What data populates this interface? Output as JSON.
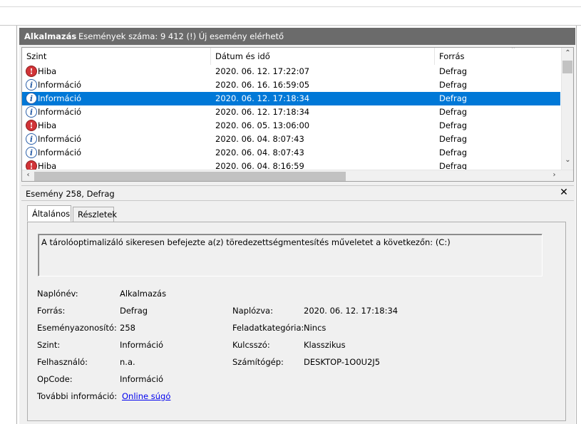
{
  "header": {
    "log_name": "Alkalmazás",
    "event_count": "Események száma: 9 412 (!) Új esemény elérhető"
  },
  "list": {
    "columns": [
      "Szint",
      "Dátum és idő",
      "Forrás"
    ],
    "rows": [
      {
        "icon": "error-icon",
        "level": "Hiba",
        "datetime": "2020. 06. 12. 17:22:07",
        "source": "Defrag"
      },
      {
        "icon": "info-icon",
        "level": "Információ",
        "datetime": "2020. 06. 16. 16:59:05",
        "source": "Defrag"
      },
      {
        "icon": "info-icon",
        "level": "Információ",
        "datetime": "2020. 06. 12. 17:18:34",
        "source": "Defrag",
        "selected": true
      },
      {
        "icon": "info-icon",
        "level": "Információ",
        "datetime": "2020. 06. 12. 17:18:34",
        "source": "Defrag"
      },
      {
        "icon": "error-icon",
        "level": "Hiba",
        "datetime": "2020. 06. 05. 13:06:00",
        "source": "Defrag"
      },
      {
        "icon": "info-icon",
        "level": "Információ",
        "datetime": "2020. 06. 04. 8:07:43",
        "source": "Defrag"
      },
      {
        "icon": "info-icon",
        "level": "Információ",
        "datetime": "2020. 06. 04. 8:07:43",
        "source": "Defrag"
      },
      {
        "icon": "error-icon",
        "level": "Hiba",
        "datetime": "2020. 06. 04. 8:16:59",
        "source": "Defrag"
      }
    ]
  },
  "event": {
    "title": "Esemény 258, Defrag",
    "tabs": [
      "Általános",
      "Részletek"
    ],
    "description": "A tárolóoptimalizáló sikeresen befejezte a(z) töredezettségmentesítés műveletet a következőn: (C:)",
    "left_fields": [
      {
        "label": "Naplónév:",
        "value": "Alkalmazás"
      },
      {
        "label": "Forrás:",
        "value": "Defrag"
      },
      {
        "label": "Eseményazonosító:",
        "value": "258"
      },
      {
        "label": "Szint:",
        "value": "Információ"
      },
      {
        "label": "Felhasználó:",
        "value": "n.a."
      },
      {
        "label": "OpCode:",
        "value": "Információ"
      },
      {
        "label": "További információ:",
        "value": "Online súgó"
      }
    ],
    "right_fields": [
      {
        "label": "Naplózva:",
        "value": "2020. 06. 12. 17:18:34"
      },
      {
        "label": "Feladatkategória:",
        "value": "Nincs"
      },
      {
        "label": "Kulcsszó:",
        "value": "Klasszikus"
      },
      {
        "label": "Számítógép:",
        "value": "DESKTOP-1O0U2J5"
      }
    ]
  },
  "colors": {
    "selection": "#0078d7",
    "header_bar": "#6b6b6b",
    "error": "#d13438",
    "info": "#2b5fa8"
  }
}
